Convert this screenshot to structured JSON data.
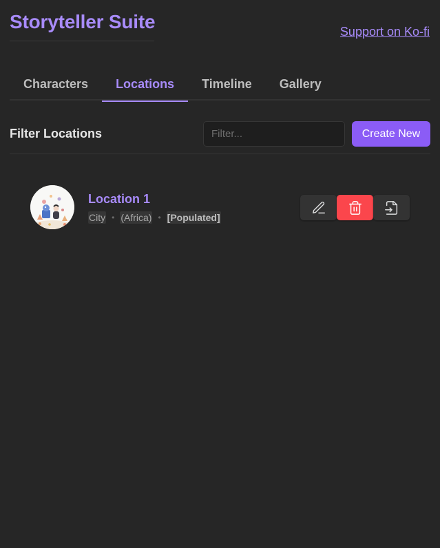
{
  "header": {
    "title": "Storyteller Suite",
    "support_link": "Support on Ko-fi"
  },
  "tabs": [
    {
      "label": "Characters",
      "active": false
    },
    {
      "label": "Locations",
      "active": true
    },
    {
      "label": "Timeline",
      "active": false
    },
    {
      "label": "Gallery",
      "active": false
    }
  ],
  "filter": {
    "label": "Filter Locations",
    "placeholder": "Filter...",
    "value": "",
    "create_label": "Create New"
  },
  "locations": [
    {
      "name": "Location 1",
      "type": "City",
      "region": "(Africa)",
      "status": "[Populated]",
      "actions": [
        "edit-icon",
        "trash-icon",
        "open-file-icon"
      ]
    }
  ],
  "colors": {
    "accent": "#a88bfa",
    "button": "#8b5cf6",
    "danger": "#fb464c",
    "background": "#262626"
  }
}
